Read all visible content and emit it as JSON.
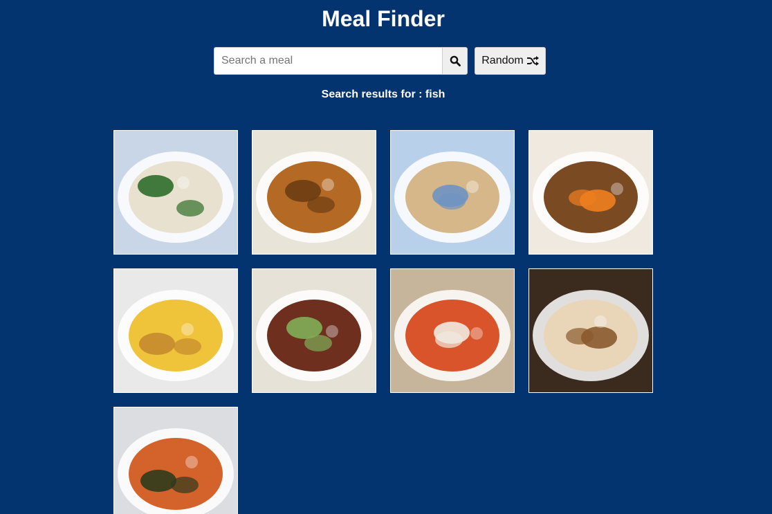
{
  "app": {
    "title": "Meal Finder"
  },
  "search": {
    "placeholder": "Search a meal",
    "value": "",
    "search_icon": "search-icon",
    "random_label": "Random",
    "random_icon": "shuffle-icon"
  },
  "results": {
    "heading": "Search results for : fish",
    "meals": [
      {
        "name": "meal-fish-pie",
        "colors": [
          "#c9d6e8",
          "#e9e1cf",
          "#2f6d2a"
        ]
      },
      {
        "name": "meal-fish-croquettes",
        "colors": [
          "#e8e4d8",
          "#b46a24",
          "#6b3d12"
        ]
      },
      {
        "name": "meal-fish-gratin",
        "colors": [
          "#b9d0ea",
          "#d6b78a",
          "#6f93c2"
        ]
      },
      {
        "name": "meal-fried-fish-carrots",
        "colors": [
          "#efe9df",
          "#7a4a22",
          "#ef7f1f"
        ]
      },
      {
        "name": "meal-ackee-saltfish",
        "colors": [
          "#e9e9e9",
          "#f0c43a",
          "#c58a2f"
        ]
      },
      {
        "name": "meal-grilled-sardines",
        "colors": [
          "#e7e2d7",
          "#6e2f1e",
          "#7fae58"
        ]
      },
      {
        "name": "meal-seafood-soup",
        "colors": [
          "#c6b49b",
          "#d9542a",
          "#f1eadf"
        ]
      },
      {
        "name": "meal-fish-tacos",
        "colors": [
          "#3b2a1e",
          "#e9d5b8",
          "#8a5a2e"
        ]
      },
      {
        "name": "meal-seafood-stew",
        "colors": [
          "#dcdde1",
          "#d4622b",
          "#2f3b1c"
        ]
      }
    ]
  }
}
